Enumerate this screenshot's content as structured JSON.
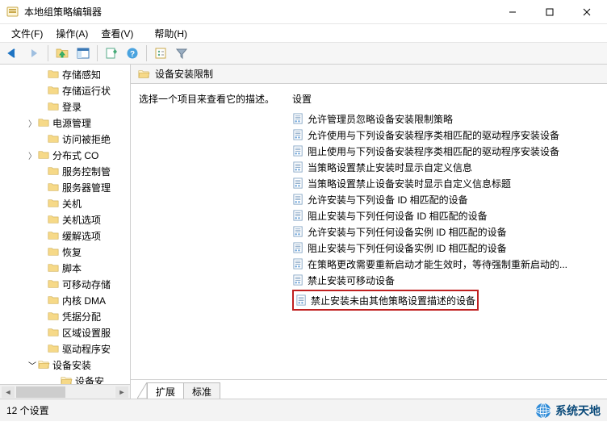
{
  "window": {
    "title": "本地组策略编辑器"
  },
  "menu": {
    "file": "文件(F)",
    "action": "操作(A)",
    "view": "查看(V)",
    "help": "帮助(H)"
  },
  "tree": {
    "n0": "存储感知",
    "n1": "存储运行状",
    "n2": "登录",
    "n3": "电源管理",
    "n4": "访问被拒绝",
    "n5": "分布式 CO",
    "n6": "服务控制管",
    "n7": "服务器管理",
    "n8": "关机",
    "n9": "关机选项",
    "n10": "缓解选项",
    "n11": "恢复",
    "n12": "脚本",
    "n13": "可移动存储",
    "n14": "内核 DMA",
    "n15": "凭据分配",
    "n16": "区域设置服",
    "n17": "驱动程序安",
    "n18": "设备安装",
    "n19": "设备安"
  },
  "header": "设备安装限制",
  "descpane": "选择一个项目来查看它的描述。",
  "colheader": "设置",
  "items": {
    "i0": "允许管理员忽略设备安装限制策略",
    "i1": "允许使用与下列设备安装程序类相匹配的驱动程序安装设备",
    "i2": "阻止使用与下列设备安装程序类相匹配的驱动程序安装设备",
    "i3": "当策略设置禁止安装时显示自定义信息",
    "i4": "当策略设置禁止设备安装时显示自定义信息标题",
    "i5": "允许安装与下列设备 ID 相匹配的设备",
    "i6": "阻止安装与下列任何设备 ID 相匹配的设备",
    "i7": "允许安装与下列任何设备实例 ID 相匹配的设备",
    "i8": "阻止安装与下列任何设备实例 ID 相匹配的设备",
    "i9": "在策略更改需要重新启动才能生效时，等待强制重新启动的...",
    "i10": "禁止安装可移动设备",
    "i11": "禁止安装未由其他策略设置描述的设备"
  },
  "tabs": {
    "ext": "扩展",
    "std": "标准"
  },
  "status": "12 个设置",
  "watermark": "系统天地"
}
